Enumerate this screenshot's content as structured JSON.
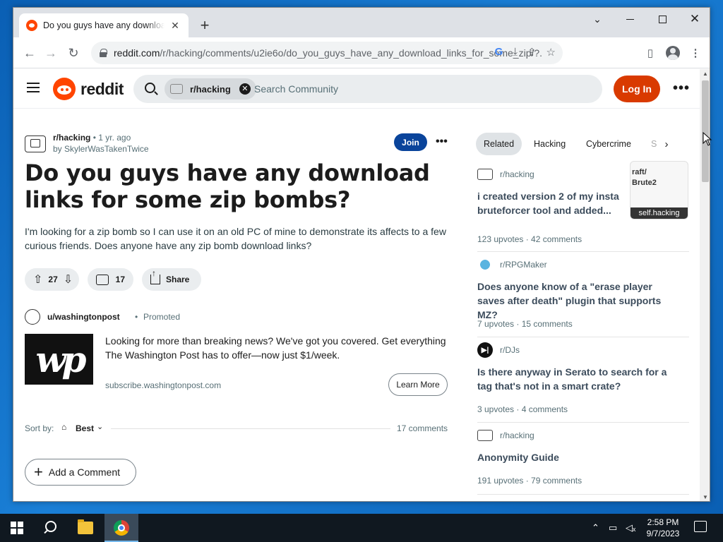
{
  "browser": {
    "tab_title": "Do you guys have any download links for some zip bombs? : r/hacking",
    "tab_close": "✕",
    "new_tab": "+",
    "url_host": "reddit.com",
    "url_path": "/r/hacking/comments/u2ie6o/do_you_guys_have_any_download_links_for_some_zip/?..."
  },
  "header": {
    "logo_text": "reddit",
    "search_chip": "r/hacking",
    "search_placeholder": "Search Community",
    "login_label": "Log In",
    "more": "•••"
  },
  "post": {
    "subreddit": "r/hacking",
    "age": "• 1 yr. ago",
    "author": "by SkylerWasTakenTwice",
    "join_label": "Join",
    "more": "•••",
    "title": "Do you guys have any download links for some zip bombs?",
    "body": "I'm looking for a zip bomb so I can use it on an old PC of mine to demonstrate its affects to a few curious friends. Does anyone have any zip bomb download links?",
    "votes": "27",
    "comments": "17",
    "share_label": "Share"
  },
  "promo": {
    "user": "u/washingtonpost",
    "dot": "•",
    "tag": "Promoted",
    "logo_text": "wp",
    "text": "Looking for more than breaking news? We've got you covered. Get everything The Washington Post has to offer—now just $1/week.",
    "domain": "subscribe.washingtonpost.com",
    "cta": "Learn More"
  },
  "sort": {
    "label": "Sort by:",
    "value": "Best",
    "count": "17 comments"
  },
  "add_comment": "Add a Comment",
  "sidebar": {
    "tabs": [
      "Related",
      "Hacking",
      "Cybercrime",
      "S"
    ],
    "related": [
      {
        "sub": "r/hacking",
        "title": "i created version 2 of my insta bruteforcer tool and added...",
        "stats": "123 upvotes · 42 comments",
        "thumb_text": "raft/\nBrute2",
        "thumb_label": "self.hacking"
      },
      {
        "sub": "r/RPGMaker",
        "title": "Does anyone know of a \"erase player saves after death\" plugin that supports MZ?",
        "stats": "7 upvotes · 15 comments"
      },
      {
        "sub": "r/DJs",
        "title": "Is there anyway in Serato to search for a tag that's not in a smart crate?",
        "stats": "3 upvotes · 4 comments"
      },
      {
        "sub": "r/hacking",
        "title": "Anonymity Guide",
        "stats": "191 upvotes · 79 comments"
      }
    ]
  },
  "taskbar": {
    "time": "2:58 PM",
    "date": "9/7/2023"
  }
}
